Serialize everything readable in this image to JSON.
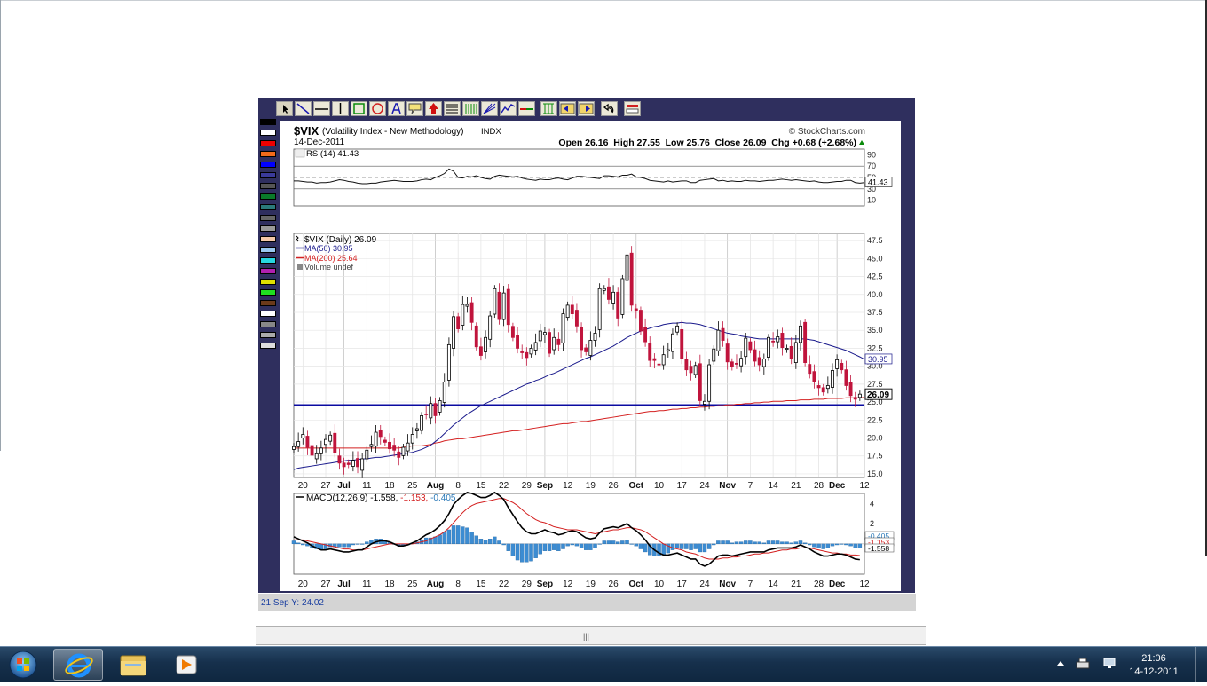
{
  "window": {
    "status_text": "21 Sep Y: 24.02"
  },
  "chart_header": {
    "symbol": "$VIX",
    "name": "(Volatility Index - New Methodology)",
    "exchange": "INDX",
    "copyright": "© StockCharts.com",
    "date": "14-Dec-2011",
    "ohlc_text": "Open 26.16  High 27.55  Low 25.76  Close 26.09  Chg +0.68 (+2.68%)"
  },
  "legends": {
    "rsi": "RSI(14) 41.43",
    "price": "$VIX (Daily) 26.09",
    "ma50": "MA(50) 30.95",
    "ma200": "MA(200) 25.64",
    "volume": "Volume undef",
    "macd_main": "MACD(12,26,9) -1.558,",
    "macd_signal": "-1.153,",
    "macd_hist": "-0.405"
  },
  "x_axis_labels": [
    {
      "text": "20",
      "i": 2
    },
    {
      "text": "27",
      "i": 7
    },
    {
      "text": "Jul",
      "i": 11,
      "bold": true
    },
    {
      "text": "11",
      "i": 16
    },
    {
      "text": "18",
      "i": 21
    },
    {
      "text": "25",
      "i": 26
    },
    {
      "text": "Aug",
      "i": 31,
      "bold": true
    },
    {
      "text": "8",
      "i": 36
    },
    {
      "text": "15",
      "i": 41
    },
    {
      "text": "22",
      "i": 46
    },
    {
      "text": "29",
      "i": 51
    },
    {
      "text": "Sep",
      "i": 55,
      "bold": true
    },
    {
      "text": "12",
      "i": 60
    },
    {
      "text": "19",
      "i": 65
    },
    {
      "text": "26",
      "i": 70
    },
    {
      "text": "Oct",
      "i": 75,
      "bold": true
    },
    {
      "text": "10",
      "i": 80
    },
    {
      "text": "17",
      "i": 85
    },
    {
      "text": "24",
      "i": 90
    },
    {
      "text": "Nov",
      "i": 95,
      "bold": true
    },
    {
      "text": "7",
      "i": 100
    },
    {
      "text": "14",
      "i": 105
    },
    {
      "text": "21",
      "i": 110
    },
    {
      "text": "28",
      "i": 115
    },
    {
      "text": "Dec",
      "i": 119,
      "bold": true
    },
    {
      "text": "12",
      "i": 125
    }
  ],
  "taskbar": {
    "time": "21:06",
    "date": "14-12-2011"
  },
  "colors": {
    "up": "#000000",
    "down": "#c0143c",
    "ma50": "#1a1a8c",
    "ma200": "#d42020",
    "support": "#0a0aa0",
    "hist": "#3c8cd2"
  },
  "chart_data": [
    {
      "type": "line",
      "title": "RSI(14) 41.43",
      "ylim": [
        0,
        100
      ],
      "yticks": [
        90,
        70,
        50,
        30,
        10
      ],
      "current_label": "41.43",
      "values": [
        44,
        44,
        43,
        42,
        42,
        40,
        41,
        41,
        42,
        44,
        46,
        45,
        43,
        42,
        40,
        39,
        39,
        40,
        40,
        42,
        43,
        44,
        45,
        44,
        43,
        43,
        43,
        44,
        46,
        47,
        46,
        50,
        53,
        57,
        65,
        61,
        50,
        49,
        52,
        51,
        53,
        50,
        48,
        47,
        52,
        54,
        53,
        52,
        51,
        52,
        49,
        47,
        46,
        45,
        47,
        46,
        46,
        48,
        49,
        47,
        46,
        49,
        52,
        52,
        51,
        50,
        49,
        48,
        53,
        53,
        52,
        51,
        54,
        54,
        56,
        51,
        50,
        48,
        45,
        44,
        43,
        42,
        44,
        42,
        43,
        44,
        44,
        41,
        41,
        45,
        46,
        47,
        48,
        44,
        45,
        43,
        44,
        43,
        43,
        45,
        44,
        44,
        43,
        44,
        45,
        45,
        46,
        47,
        46,
        45,
        46,
        45,
        44,
        43,
        44,
        42,
        41,
        41,
        42,
        43,
        43,
        45,
        45,
        41,
        40,
        41
      ],
      "dash_level": 50
    },
    {
      "type": "candlestick",
      "title": "$VIX (Daily) 26.09",
      "ylim": [
        14.5,
        48.5
      ],
      "yticks": [
        47.5,
        45.0,
        42.5,
        40.0,
        37.5,
        35.0,
        32.5,
        30.0,
        27.5,
        25.0,
        22.5,
        20.0,
        17.5,
        15.0
      ],
      "current_label": "26.09",
      "ma50_label": "30.95",
      "support_level": 24.6,
      "close": [
        18.8,
        19.5,
        20.5,
        18.7,
        17.6,
        17.8,
        18.6,
        19.8,
        20.4,
        18.0,
        16.5,
        16.0,
        16.3,
        16.9,
        16.0,
        17.1,
        18.3,
        19.1,
        20.8,
        20.2,
        19.4,
        18.5,
        18.3,
        17.3,
        18.7,
        19.3,
        20.5,
        21.3,
        23.1,
        23.3,
        24.8,
        23.1,
        25.2,
        27.8,
        33.0,
        36.9,
        35.2,
        38.6,
        38.6,
        36.1,
        32.7,
        31.5,
        34.0,
        37.0,
        40.8,
        36.5,
        40.2,
        35.8,
        34.0,
        32.5,
        31.9,
        31.2,
        32.5,
        33.3,
        34.9,
        34.7,
        31.8,
        34.0,
        33.0,
        37.3,
        38.5,
        37.3,
        35.6,
        32.3,
        32.0,
        33.6,
        34.6,
        40.8,
        40.8,
        39.3,
        40.3,
        36.7,
        42.2,
        45.5,
        38.5,
        37.8,
        34.9,
        33.4,
        30.8,
        30.8,
        30.2,
        31.6,
        32.3,
        34.5,
        35.6,
        31.0,
        29.5,
        29.1,
        30.1,
        25.2,
        25.1,
        30.2,
        32.4,
        35.0,
        33.6,
        30.6,
        29.9,
        30.3,
        31.1,
        33.9,
        32.3,
        30.7,
        30.2,
        31.0,
        34.0,
        33.4,
        34.1,
        32.6,
        32.5,
        31.0,
        33.3,
        35.6,
        30.5,
        29.0,
        27.8,
        27.0,
        26.4,
        27.3,
        29.4,
        30.9,
        29.5,
        27.3,
        25.9,
        25.4,
        26.1
      ],
      "ma50": [
        15.6,
        15.8,
        15.9,
        16.0,
        16.1,
        16.2,
        16.3,
        16.4,
        16.5,
        16.6,
        16.7,
        16.8,
        16.9,
        16.9,
        17.0,
        17.1,
        17.1,
        17.2,
        17.3,
        17.3,
        17.4,
        17.5,
        17.6,
        17.7,
        17.8,
        17.9,
        18.0,
        18.2,
        18.4,
        18.7,
        19.0,
        19.5,
        20.0,
        20.6,
        21.2,
        21.8,
        22.3,
        22.8,
        23.3,
        23.7,
        24.1,
        24.5,
        24.8,
        25.1,
        25.4,
        25.7,
        26.0,
        26.3,
        26.6,
        26.9,
        27.2,
        27.5,
        27.7,
        28.0,
        28.2,
        28.5,
        28.8,
        29.0,
        29.3,
        29.6,
        29.9,
        30.2,
        30.5,
        30.8,
        31.1,
        31.3,
        31.6,
        31.9,
        32.2,
        32.5,
        32.8,
        33.2,
        33.6,
        34.0,
        34.3,
        34.6,
        34.9,
        35.1,
        35.3,
        35.5,
        35.6,
        35.8,
        35.9,
        36.0,
        36.0,
        36.1,
        36.0,
        36.0,
        35.9,
        35.8,
        35.6,
        35.4,
        35.2,
        35.0,
        34.8,
        34.6,
        34.5,
        34.4,
        34.2,
        34.1,
        34.0,
        33.9,
        33.8,
        33.8,
        33.8,
        33.8,
        33.8,
        33.8,
        33.8,
        33.8,
        33.8,
        33.8,
        33.8,
        33.7,
        33.6,
        33.4,
        33.2,
        33.0,
        32.8,
        32.6,
        32.4,
        32.2,
        31.9,
        31.6,
        31.3,
        30.95
      ],
      "ma200": [
        18.6,
        18.6,
        18.6,
        18.6,
        18.6,
        18.6,
        18.6,
        18.6,
        18.6,
        18.6,
        18.6,
        18.6,
        18.6,
        18.6,
        18.6,
        18.6,
        18.6,
        18.6,
        18.6,
        18.6,
        18.6,
        18.6,
        18.6,
        18.6,
        18.7,
        18.8,
        18.9,
        18.9,
        18.9,
        19.0,
        19.1,
        19.3,
        19.4,
        19.6,
        19.7,
        19.8,
        19.9,
        19.9,
        20.0,
        20.1,
        20.2,
        20.3,
        20.4,
        20.5,
        20.6,
        20.7,
        20.8,
        20.9,
        21.0,
        21.0,
        21.1,
        21.2,
        21.3,
        21.4,
        21.5,
        21.6,
        21.7,
        21.8,
        21.9,
        22.0,
        22.0,
        22.1,
        22.2,
        22.3,
        22.3,
        22.4,
        22.5,
        22.6,
        22.7,
        22.8,
        22.9,
        23.0,
        23.1,
        23.2,
        23.3,
        23.4,
        23.5,
        23.6,
        23.7,
        23.7,
        23.8,
        23.8,
        23.9,
        24.0,
        24.0,
        24.1,
        24.1,
        24.2,
        24.2,
        24.3,
        24.3,
        24.4,
        24.4,
        24.5,
        24.5,
        24.6,
        24.6,
        24.7,
        24.7,
        24.8,
        24.8,
        24.9,
        24.9,
        25.0,
        25.0,
        25.1,
        25.1,
        25.1,
        25.2,
        25.2,
        25.2,
        25.3,
        25.3,
        25.3,
        25.4,
        25.4,
        25.4,
        25.5,
        25.5,
        25.5,
        25.5,
        25.6,
        25.6,
        25.6,
        25.6,
        25.64
      ]
    },
    {
      "type": "line",
      "title": "MACD(12,26,9)",
      "ylim": [
        -3,
        5
      ],
      "yticks": [
        4,
        2
      ],
      "labels": [
        "-0.405",
        "-1.153",
        "-1.558"
      ],
      "macd": [
        0.7,
        0.5,
        0.3,
        0.1,
        -0.2,
        -0.4,
        -0.6,
        -0.6,
        -0.5,
        -0.6,
        -0.7,
        -0.8,
        -0.8,
        -0.7,
        -0.6,
        -0.6,
        -0.3,
        0.0,
        0.2,
        0.3,
        0.3,
        0.2,
        0.0,
        -0.2,
        -0.2,
        -0.1,
        0.1,
        0.3,
        0.6,
        0.9,
        1.1,
        1.4,
        1.8,
        2.3,
        3.0,
        3.9,
        4.4,
        4.8,
        5.1,
        5.0,
        4.8,
        4.6,
        4.6,
        4.8,
        5.1,
        4.8,
        4.4,
        3.6,
        2.9,
        2.2,
        1.6,
        1.2,
        1.0,
        1.0,
        1.2,
        1.4,
        1.2,
        1.1,
        0.9,
        1.0,
        1.2,
        1.3,
        1.2,
        0.9,
        0.6,
        0.5,
        0.6,
        1.1,
        1.5,
        1.6,
        1.7,
        1.6,
        1.8,
        2.0,
        1.6,
        1.3,
        0.9,
        0.4,
        -0.2,
        -0.6,
        -0.9,
        -1.1,
        -1.1,
        -1.0,
        -0.9,
        -1.1,
        -1.3,
        -1.5,
        -1.5,
        -2.0,
        -2.2,
        -2.0,
        -1.6,
        -1.2,
        -1.1,
        -1.1,
        -1.2,
        -1.1,
        -1.0,
        -0.9,
        -0.8,
        -0.8,
        -0.8,
        -0.8,
        -0.6,
        -0.5,
        -0.4,
        -0.4,
        -0.4,
        -0.4,
        -0.3,
        -0.1,
        -0.3,
        -0.5,
        -0.8,
        -1.0,
        -1.2,
        -1.2,
        -1.1,
        -1.0,
        -1.0,
        -1.1,
        -1.3,
        -1.5,
        -1.56
      ],
      "signal": [
        0.4,
        0.4,
        0.4,
        0.3,
        0.2,
        0.1,
        0.0,
        -0.1,
        -0.2,
        -0.3,
        -0.4,
        -0.5,
        -0.5,
        -0.6,
        -0.6,
        -0.6,
        -0.5,
        -0.4,
        -0.3,
        -0.2,
        -0.1,
        0.0,
        0.0,
        0.0,
        0.0,
        0.0,
        0.0,
        0.1,
        0.2,
        0.3,
        0.5,
        0.7,
        0.9,
        1.2,
        1.6,
        2.1,
        2.6,
        3.1,
        3.5,
        3.8,
        4.0,
        4.1,
        4.2,
        4.3,
        4.4,
        4.5,
        4.5,
        4.3,
        4.1,
        3.8,
        3.4,
        3.0,
        2.7,
        2.4,
        2.2,
        2.1,
        1.9,
        1.7,
        1.6,
        1.5,
        1.4,
        1.4,
        1.4,
        1.3,
        1.2,
        1.1,
        1.0,
        1.1,
        1.2,
        1.3,
        1.4,
        1.4,
        1.5,
        1.6,
        1.6,
        1.5,
        1.4,
        1.2,
        0.9,
        0.6,
        0.3,
        0.0,
        -0.2,
        -0.4,
        -0.5,
        -0.6,
        -0.8,
        -0.9,
        -1.0,
        -1.2,
        -1.4,
        -1.5,
        -1.5,
        -1.5,
        -1.4,
        -1.4,
        -1.3,
        -1.3,
        -1.2,
        -1.2,
        -1.1,
        -1.0,
        -1.0,
        -0.9,
        -0.9,
        -0.8,
        -0.7,
        -0.6,
        -0.6,
        -0.5,
        -0.5,
        -0.4,
        -0.4,
        -0.4,
        -0.5,
        -0.6,
        -0.7,
        -0.8,
        -0.9,
        -0.9,
        -1.0,
        -1.0,
        -1.1,
        -1.1,
        -1.15
      ],
      "hist_color": "#3c8cd2"
    }
  ]
}
